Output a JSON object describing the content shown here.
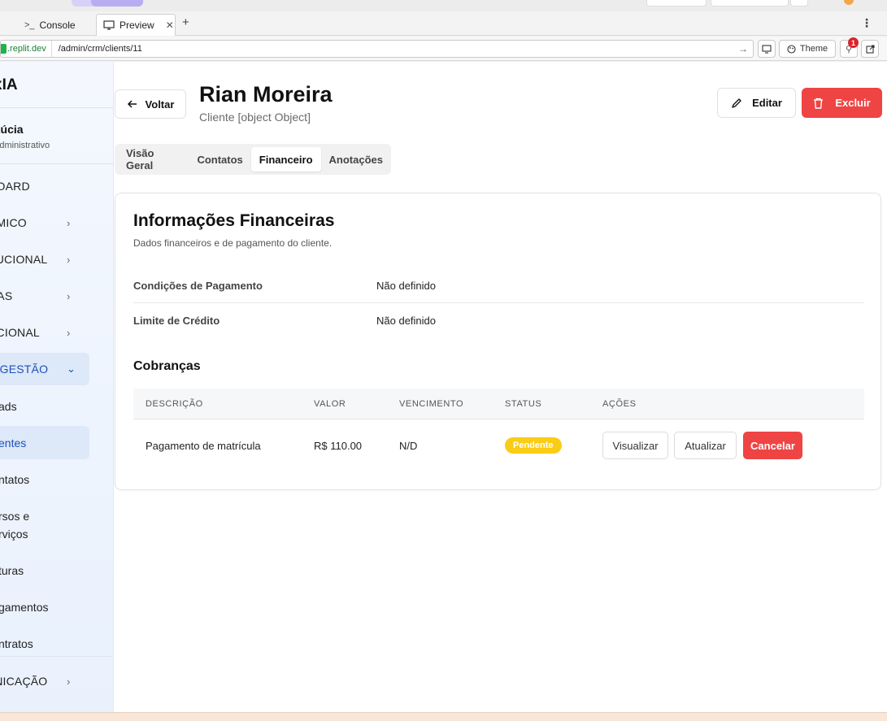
{
  "browser": {
    "tabs": [
      {
        "label": "Console",
        "icon": "terminal-icon"
      },
      {
        "label": "Preview",
        "icon": "monitor-icon"
      }
    ],
    "new_tab": "+",
    "url_domain": ".replit.dev",
    "url_path": "/admin/crm/clients/11",
    "theme_label": "Theme",
    "notification_count": "1"
  },
  "sidebar": {
    "brand": "xIA",
    "user_name": "Lúcia",
    "user_role": "Administrativo",
    "nav": [
      {
        "label": "BOARD"
      },
      {
        "label": "ÊMICO"
      },
      {
        "label": "TUCIONAL"
      },
      {
        "label": "DAS"
      },
      {
        "label": "ACIONAL"
      },
      {
        "label": "& GESTÃO"
      }
    ],
    "subitems": [
      {
        "label": "ads"
      },
      {
        "label": "entes"
      },
      {
        "label": "ntatos"
      },
      {
        "label": "rsos e"
      },
      {
        "label": "rviços"
      },
      {
        "label": "turas"
      },
      {
        "label": "gamentos"
      },
      {
        "label": "ntratos"
      }
    ],
    "last_nav": "JNICAÇÃO"
  },
  "header": {
    "back_label": "Voltar",
    "client_name": "Rian Moreira",
    "subtitle": "Cliente [object Object]",
    "edit_label": "Editar",
    "delete_label": "Excluir"
  },
  "tabs": [
    "Visão Geral",
    "Contatos",
    "Financeiro",
    "Anotações"
  ],
  "selected_tab": "Financeiro",
  "financial": {
    "title": "Informações Financeiras",
    "description": "Dados financeiros e de pagamento do cliente.",
    "payment_terms_label": "Condições de Pagamento",
    "payment_terms_value": "Não definido",
    "credit_limit_label": "Limite de Crédito",
    "credit_limit_value": "Não definido",
    "charges_title": "Cobranças",
    "columns": [
      "DESCRIÇÃO",
      "VALOR",
      "VENCIMENTO",
      "STATUS",
      "AÇÕES"
    ],
    "rows": [
      {
        "description": "Pagamento de matrícula",
        "value": "R$ 110.00",
        "due": "N/D",
        "status": "Pendente",
        "actions": [
          "Visualizar",
          "Atualizar",
          "Cancelar"
        ]
      }
    ]
  },
  "colors": {
    "accent_red": "#ef4444",
    "status_pending": "#facc15",
    "sidebar_active": "#1d4fb8"
  }
}
